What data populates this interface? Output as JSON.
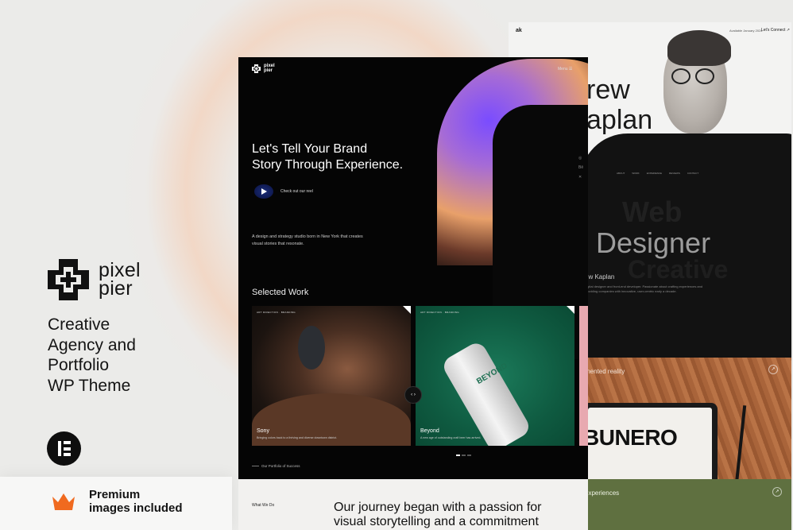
{
  "brand": {
    "logo_line1": "pixel",
    "logo_line2": "pier",
    "tagline_lines": [
      "Creative",
      "Agency and",
      "Portfolio",
      "WP Theme"
    ],
    "premium_line1": "Premium",
    "premium_line2": "images included",
    "accent_color": "#f06a1f"
  },
  "main": {
    "logo_line1": "pixel",
    "logo_line2": "pier",
    "menu_label": "Menu",
    "hero_line1": "Let's Tell Your Brand",
    "hero_line2": "Story Through Experience.",
    "reel_label": "Check out our reel",
    "description": "A design and strategy studio born in New York that creates visual stories that resonate.",
    "selected_work": "Selected Work",
    "cards": [
      {
        "meta": "ART DIRECTION · BRANDING",
        "title": "Sony",
        "caption": "Bringing colors back to a thriving and diverse downtown district."
      },
      {
        "meta": "ART DIRECTION · BRANDING",
        "title": "Beyond",
        "caption": "A new age of outstanding craft beer has arrived."
      }
    ],
    "can_label": "BEYOND",
    "portfolio_label": "Our Portfolio of Success"
  },
  "below": {
    "what_we_do": "What We Do",
    "story": "Our journey began with a passion for visual storytelling and a commitment"
  },
  "back": {
    "ak": "ak",
    "available": "Available January 2024",
    "connect": "Let's Connect",
    "name_line1": "rew",
    "name_line2": "aplan",
    "nav_items": [
      "ABOUT",
      "WORK",
      "EXPERIENCE",
      "REVIEWS",
      "CONTACT"
    ],
    "role_web": "Web",
    "role_designer": "Designer",
    "role_creative": "Creative",
    "who": "ew Kaplan",
    "bio": "digital designer and front-end developer. Passionate about crafting experiences and providing companies with innovative, user-centric early a decade."
  },
  "wood": {
    "label": "mented reality",
    "bunero": "BUNERO"
  },
  "green": {
    "label": "experiences"
  }
}
